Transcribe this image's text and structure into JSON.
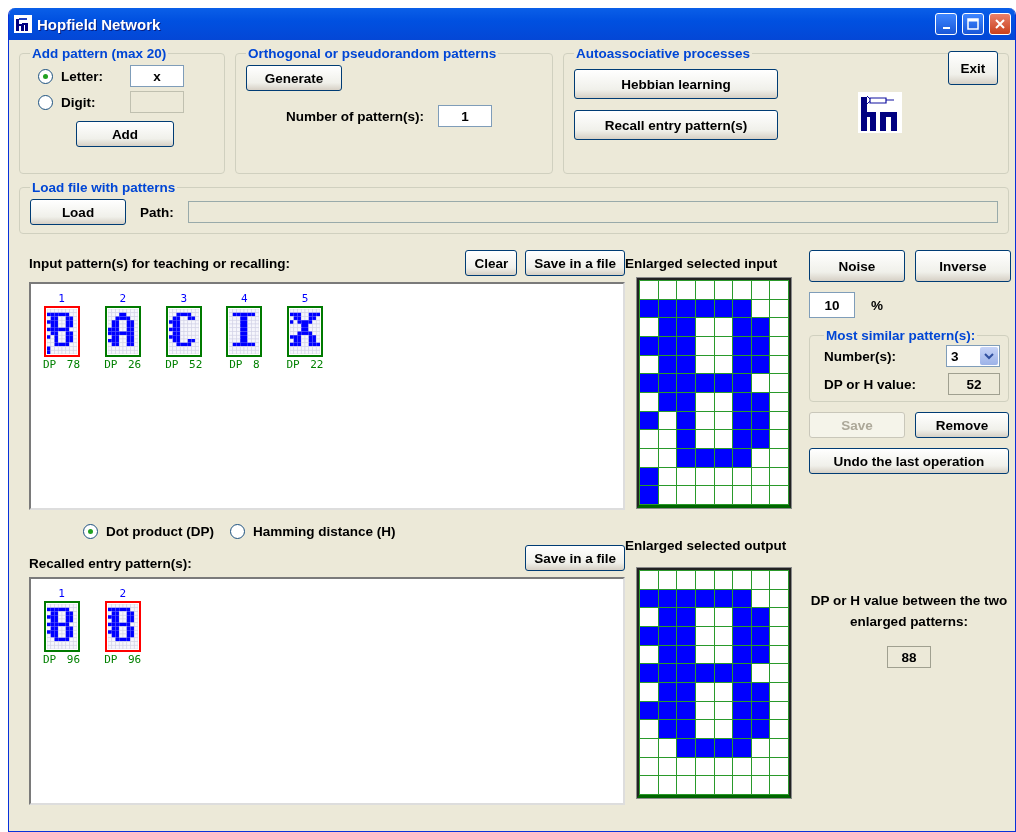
{
  "window": {
    "title": "Hopfield Network"
  },
  "add_pattern": {
    "title": "Add pattern (max 20)",
    "options": [
      {
        "label": "Letter:",
        "selected": true,
        "value": "x"
      },
      {
        "label": "Digit:",
        "selected": false
      }
    ],
    "button": "Add"
  },
  "orthogonal": {
    "title": "Orthogonal or pseudorandom patterns",
    "button": "Generate",
    "count_label": "Number of pattern(s):",
    "count": "1"
  },
  "autoassociative": {
    "title": "Autoassociative processes",
    "buttons": [
      "Hebbian learning",
      "Recall entry pattern(s)"
    ]
  },
  "exit": "Exit",
  "load": {
    "title": "Load file with patterns",
    "button": "Load",
    "path_label": "Path:"
  },
  "input": {
    "label": "Input pattern(s) for teaching or recalling:",
    "buttons": [
      "Clear",
      "Save in a file"
    ],
    "patterns": [
      {
        "number": "1",
        "score": "DP 78",
        "selected": true,
        "cells": [
          [
            false,
            false,
            false,
            false,
            false,
            false,
            false,
            false
          ],
          [
            true,
            true,
            true,
            true,
            true,
            true,
            false,
            false
          ],
          [
            false,
            true,
            true,
            false,
            false,
            true,
            true,
            false
          ],
          [
            true,
            true,
            true,
            false,
            false,
            true,
            true,
            false
          ],
          [
            false,
            true,
            true,
            false,
            false,
            true,
            true,
            false
          ],
          [
            true,
            true,
            true,
            true,
            true,
            true,
            false,
            false
          ],
          [
            false,
            true,
            true,
            false,
            false,
            true,
            true,
            false
          ],
          [
            true,
            false,
            true,
            false,
            false,
            true,
            true,
            false
          ],
          [
            false,
            false,
            true,
            false,
            false,
            true,
            true,
            false
          ],
          [
            false,
            false,
            true,
            true,
            true,
            true,
            false,
            false
          ],
          [
            true,
            false,
            false,
            false,
            false,
            false,
            false,
            false
          ],
          [
            true,
            false,
            false,
            false,
            false,
            false,
            false,
            false
          ]
        ]
      },
      {
        "number": "2",
        "score": "DP 26",
        "selected": false,
        "cells": [
          [
            false,
            false,
            false,
            false,
            false,
            false,
            false,
            false
          ],
          [
            false,
            false,
            false,
            true,
            true,
            false,
            false,
            false
          ],
          [
            false,
            false,
            true,
            true,
            true,
            true,
            false,
            false
          ],
          [
            false,
            true,
            true,
            false,
            false,
            true,
            true,
            false
          ],
          [
            false,
            true,
            true,
            false,
            false,
            true,
            true,
            false
          ],
          [
            true,
            true,
            true,
            false,
            false,
            true,
            true,
            false
          ],
          [
            true,
            true,
            true,
            true,
            true,
            true,
            true,
            false
          ],
          [
            false,
            true,
            true,
            false,
            false,
            true,
            true,
            false
          ],
          [
            true,
            true,
            true,
            false,
            false,
            true,
            true,
            false
          ],
          [
            false,
            true,
            true,
            false,
            false,
            true,
            true,
            false
          ],
          [
            false,
            false,
            false,
            false,
            false,
            false,
            false,
            false
          ],
          [
            false,
            false,
            false,
            false,
            false,
            false,
            false,
            false
          ]
        ]
      },
      {
        "number": "3",
        "score": "DP 52",
        "selected": false,
        "cells": [
          [
            false,
            false,
            false,
            false,
            false,
            false,
            false,
            false
          ],
          [
            false,
            false,
            true,
            true,
            true,
            true,
            false,
            false
          ],
          [
            false,
            true,
            true,
            false,
            false,
            true,
            true,
            false
          ],
          [
            true,
            true,
            true,
            false,
            false,
            false,
            false,
            false
          ],
          [
            false,
            true,
            true,
            false,
            false,
            false,
            false,
            false
          ],
          [
            true,
            true,
            true,
            false,
            false,
            false,
            false,
            false
          ],
          [
            false,
            true,
            true,
            false,
            false,
            false,
            false,
            false
          ],
          [
            true,
            true,
            true,
            false,
            false,
            false,
            false,
            false
          ],
          [
            false,
            true,
            true,
            false,
            false,
            true,
            true,
            false
          ],
          [
            false,
            false,
            true,
            true,
            true,
            true,
            false,
            false
          ],
          [
            false,
            false,
            false,
            false,
            false,
            false,
            false,
            false
          ],
          [
            false,
            false,
            false,
            false,
            false,
            false,
            false,
            false
          ]
        ]
      },
      {
        "number": "4",
        "score": "DP 8",
        "selected": false,
        "cells": [
          [
            false,
            false,
            false,
            false,
            false,
            false,
            false,
            false
          ],
          [
            false,
            true,
            true,
            true,
            true,
            true,
            true,
            false
          ],
          [
            false,
            false,
            false,
            true,
            true,
            false,
            false,
            false
          ],
          [
            false,
            false,
            false,
            true,
            true,
            false,
            false,
            false
          ],
          [
            false,
            false,
            false,
            true,
            true,
            false,
            false,
            false
          ],
          [
            false,
            false,
            false,
            true,
            true,
            false,
            false,
            false
          ],
          [
            false,
            false,
            false,
            true,
            true,
            false,
            false,
            false
          ],
          [
            false,
            false,
            false,
            true,
            true,
            false,
            false,
            false
          ],
          [
            false,
            false,
            false,
            true,
            true,
            false,
            false,
            false
          ],
          [
            false,
            true,
            true,
            true,
            true,
            true,
            true,
            false
          ],
          [
            false,
            false,
            false,
            false,
            false,
            false,
            false,
            false
          ],
          [
            false,
            false,
            false,
            false,
            false,
            false,
            false,
            false
          ]
        ]
      },
      {
        "number": "5",
        "score": "DP 22",
        "selected": false,
        "cells": [
          [
            false,
            false,
            false,
            false,
            false,
            false,
            false,
            false
          ],
          [
            true,
            true,
            true,
            false,
            false,
            true,
            true,
            true
          ],
          [
            false,
            true,
            true,
            false,
            false,
            true,
            true,
            false
          ],
          [
            true,
            false,
            true,
            true,
            true,
            true,
            false,
            false
          ],
          [
            false,
            false,
            false,
            true,
            true,
            false,
            false,
            false
          ],
          [
            false,
            false,
            false,
            true,
            true,
            false,
            false,
            false
          ],
          [
            false,
            false,
            true,
            true,
            true,
            true,
            false,
            false
          ],
          [
            true,
            true,
            true,
            false,
            false,
            true,
            true,
            false
          ],
          [
            false,
            true,
            true,
            false,
            false,
            true,
            true,
            false
          ],
          [
            true,
            true,
            true,
            false,
            false,
            true,
            true,
            true
          ],
          [
            false,
            false,
            false,
            false,
            false,
            false,
            false,
            false
          ],
          [
            false,
            false,
            false,
            false,
            false,
            false,
            false,
            false
          ]
        ]
      }
    ]
  },
  "measure": {
    "options": [
      {
        "label": "Dot product (DP)",
        "selected": true
      },
      {
        "label": "Hamming distance (H)",
        "selected": false
      }
    ]
  },
  "recalled": {
    "label": "Recalled entry pattern(s):",
    "button": "Save in a file",
    "patterns": [
      {
        "number": "1",
        "score": "DP 96",
        "selected": false,
        "cells": [
          [
            false,
            false,
            false,
            false,
            false,
            false,
            false,
            false
          ],
          [
            true,
            true,
            true,
            true,
            true,
            true,
            false,
            false
          ],
          [
            false,
            true,
            true,
            false,
            false,
            true,
            true,
            false
          ],
          [
            true,
            true,
            true,
            false,
            false,
            true,
            true,
            false
          ],
          [
            false,
            true,
            true,
            false,
            false,
            true,
            true,
            false
          ],
          [
            true,
            true,
            true,
            true,
            true,
            true,
            false,
            false
          ],
          [
            false,
            true,
            true,
            false,
            false,
            true,
            true,
            false
          ],
          [
            true,
            true,
            true,
            false,
            false,
            true,
            true,
            false
          ],
          [
            false,
            true,
            true,
            false,
            false,
            true,
            true,
            false
          ],
          [
            false,
            false,
            true,
            true,
            true,
            true,
            false,
            false
          ],
          [
            false,
            false,
            false,
            false,
            false,
            false,
            false,
            false
          ],
          [
            false,
            false,
            false,
            false,
            false,
            false,
            false,
            false
          ]
        ]
      },
      {
        "number": "2",
        "score": "DP 96",
        "selected": true,
        "cells": [
          [
            false,
            false,
            false,
            false,
            false,
            false,
            false,
            false
          ],
          [
            true,
            true,
            true,
            true,
            true,
            true,
            false,
            false
          ],
          [
            false,
            true,
            true,
            false,
            false,
            true,
            true,
            false
          ],
          [
            true,
            true,
            true,
            false,
            false,
            true,
            true,
            false
          ],
          [
            false,
            true,
            true,
            false,
            false,
            true,
            true,
            false
          ],
          [
            true,
            true,
            true,
            true,
            true,
            true,
            false,
            false
          ],
          [
            false,
            true,
            true,
            false,
            false,
            true,
            true,
            false
          ],
          [
            true,
            true,
            true,
            false,
            false,
            true,
            true,
            false
          ],
          [
            false,
            true,
            true,
            false,
            false,
            true,
            true,
            false
          ],
          [
            false,
            false,
            true,
            true,
            true,
            true,
            false,
            false
          ],
          [
            false,
            false,
            false,
            false,
            false,
            false,
            false,
            false
          ],
          [
            false,
            false,
            false,
            false,
            false,
            false,
            false,
            false
          ]
        ]
      }
    ]
  },
  "enlarged_input": {
    "label": "Enlarged selected input",
    "cells": [
      [
        false,
        false,
        false,
        false,
        false,
        false,
        false,
        false
      ],
      [
        true,
        true,
        true,
        true,
        true,
        true,
        false,
        false
      ],
      [
        false,
        true,
        true,
        false,
        false,
        true,
        true,
        false
      ],
      [
        true,
        true,
        true,
        false,
        false,
        true,
        true,
        false
      ],
      [
        false,
        true,
        true,
        false,
        false,
        true,
        true,
        false
      ],
      [
        true,
        true,
        true,
        true,
        true,
        true,
        false,
        false
      ],
      [
        false,
        true,
        true,
        false,
        false,
        true,
        true,
        false
      ],
      [
        true,
        false,
        true,
        false,
        false,
        true,
        true,
        false
      ],
      [
        false,
        false,
        true,
        false,
        false,
        true,
        true,
        false
      ],
      [
        false,
        false,
        true,
        true,
        true,
        true,
        false,
        false
      ],
      [
        true,
        false,
        false,
        false,
        false,
        false,
        false,
        false
      ],
      [
        true,
        false,
        false,
        false,
        false,
        false,
        false,
        false
      ]
    ]
  },
  "enlarged_output": {
    "label": "Enlarged selected output",
    "cells": [
      [
        false,
        false,
        false,
        false,
        false,
        false,
        false,
        false
      ],
      [
        true,
        true,
        true,
        true,
        true,
        true,
        false,
        false
      ],
      [
        false,
        true,
        true,
        false,
        false,
        true,
        true,
        false
      ],
      [
        true,
        true,
        true,
        false,
        false,
        true,
        true,
        false
      ],
      [
        false,
        true,
        true,
        false,
        false,
        true,
        true,
        false
      ],
      [
        true,
        true,
        true,
        true,
        true,
        true,
        false,
        false
      ],
      [
        false,
        true,
        true,
        false,
        false,
        true,
        true,
        false
      ],
      [
        true,
        true,
        true,
        false,
        false,
        true,
        true,
        false
      ],
      [
        false,
        true,
        true,
        false,
        false,
        true,
        true,
        false
      ],
      [
        false,
        false,
        true,
        true,
        true,
        true,
        false,
        false
      ],
      [
        false,
        false,
        false,
        false,
        false,
        false,
        false,
        false
      ],
      [
        false,
        false,
        false,
        false,
        false,
        false,
        false,
        false
      ]
    ]
  },
  "controls": {
    "noise": "Noise",
    "inverse": "Inverse",
    "noise_percent": "10",
    "percent_sign": "%",
    "similar": {
      "title": "Most similar pattern(s):",
      "number_label": "Number(s):",
      "number": "3",
      "value_label": "DP or H value:",
      "value": "52"
    },
    "save": {
      "label": "Save",
      "disabled": true
    },
    "remove": {
      "label": "Remove",
      "disabled": false
    },
    "undo": "Undo the last operation"
  },
  "comparison": {
    "label": "DP or H value between the two enlarged patterns:",
    "value": "88"
  }
}
